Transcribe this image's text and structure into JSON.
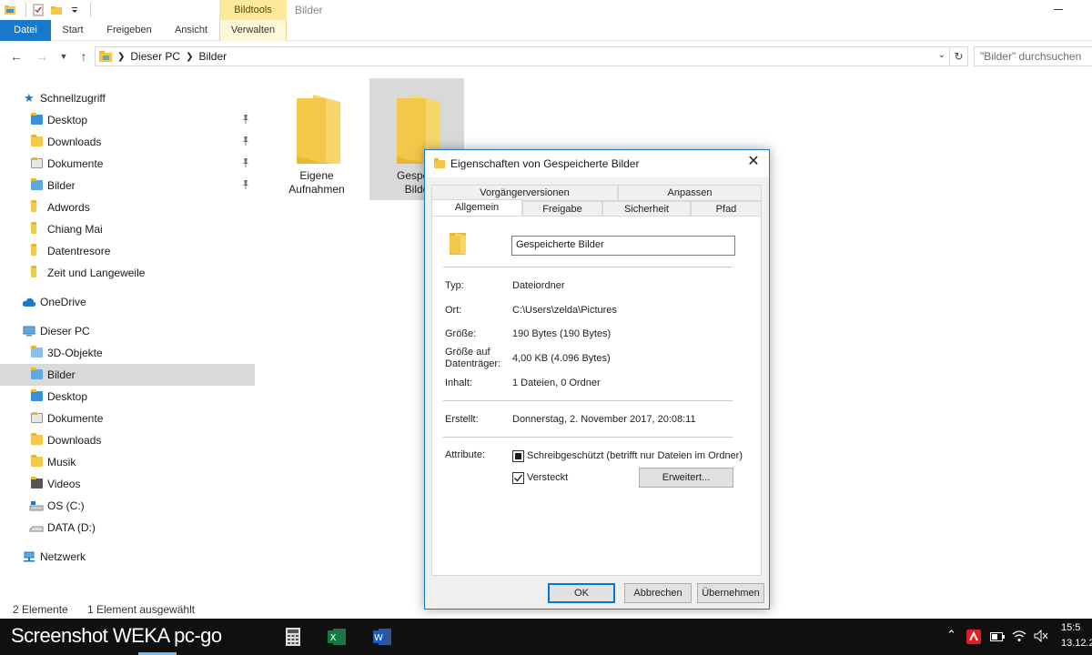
{
  "titlebar": {
    "context_tab": "Bildtools",
    "window_title": "Bilder"
  },
  "ribbon": {
    "tabs": [
      "Datei",
      "Start",
      "Freigeben",
      "Ansicht",
      "Verwalten"
    ]
  },
  "address": {
    "crumbs": [
      "Dieser PC",
      "Bilder"
    ],
    "search_placeholder": "\"Bilder\" durchsuchen"
  },
  "nav": {
    "quick_access": "Schnellzugriff",
    "quick_items": [
      "Desktop",
      "Downloads",
      "Dokumente",
      "Bilder",
      "Adwords",
      "Chiang Mai",
      "Datentresore",
      "Zeit und Langeweile"
    ],
    "onedrive": "OneDrive",
    "this_pc": "Dieser PC",
    "pc_items": [
      "3D-Objekte",
      "Bilder",
      "Desktop",
      "Dokumente",
      "Downloads",
      "Musik",
      "Videos",
      "OS (C:)",
      "DATA (D:)"
    ],
    "network": "Netzwerk"
  },
  "content": {
    "items": [
      {
        "label_line1": "Eigene",
        "label_line2": "Aufnahmen"
      },
      {
        "label_line1": "Gespeic",
        "label_line2": "Bilde"
      }
    ]
  },
  "status": {
    "count": "2 Elemente",
    "selection": "1 Element ausgewählt"
  },
  "dialog": {
    "title": "Eigenschaften von Gespeicherte Bilder",
    "tabs_top": [
      "Vorgängerversionen",
      "Anpassen"
    ],
    "tabs_bottom": [
      "Allgemein",
      "Freigabe",
      "Sicherheit",
      "Pfad"
    ],
    "name": "Gespeicherte Bilder",
    "type_label": "Typ:",
    "type_value": "Dateiordner",
    "location_label": "Ort:",
    "location_value": "C:\\Users\\zelda\\Pictures",
    "size_label": "Größe:",
    "size_value": "190 Bytes (190 Bytes)",
    "disk_size_label_1": "Größe auf",
    "disk_size_label_2": "Datenträger:",
    "disk_size_value": "4,00 KB (4.096 Bytes)",
    "contents_label": "Inhalt:",
    "contents_value": "1 Dateien, 0 Ordner",
    "created_label": "Erstellt:",
    "created_value": "Donnerstag, 2. November 2017, 20:08:11",
    "attributes_label": "Attribute:",
    "readonly_label": "Schreibgeschützt (betrifft nur Dateien im Ordner)",
    "hidden_label": "Versteckt",
    "advanced_button": "Erweitert...",
    "ok_button": "OK",
    "cancel_button": "Abbrechen",
    "apply_button": "Übernehmen"
  },
  "taskbar": {
    "brand_text": "Screenshot WEKA pc-go",
    "clock_time": "15:5",
    "clock_date": "13.12.2"
  },
  "colors": {
    "accent": "#1979ca",
    "folder": "#f3c84a",
    "selection": "#d9d9d9",
    "context_tab": "#fce999"
  }
}
